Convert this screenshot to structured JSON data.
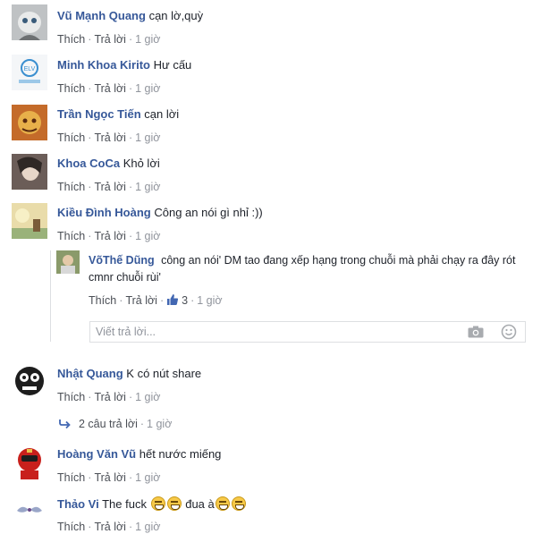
{
  "labels": {
    "like": "Thích",
    "reply": "Trả lời",
    "sep": "·"
  },
  "comments": [
    {
      "author": "Vũ Mạnh Quang",
      "text": "cạn lờ,quỳ",
      "time": "1 giờ"
    },
    {
      "author": "Minh Khoa Kirito",
      "text": "Hư cấu",
      "time": "1 giờ"
    },
    {
      "author": "Trần Ngọc Tiến",
      "text": "cạn lời",
      "time": "1 giờ"
    },
    {
      "author": "Khoa CoCa",
      "text": "Khỏ lời",
      "time": "1 giờ"
    },
    {
      "author": "Kiều Đình Hoàng",
      "text": "Công an nói gì nhỉ :))",
      "time": "1 giờ"
    },
    {
      "author": "Nhật Quang",
      "text": "K có nút share",
      "time": "1 giờ"
    },
    {
      "author": "Hoàng Văn Vũ",
      "text": "hết nước miếng",
      "time": "1 giờ"
    },
    {
      "author": "Thảo Vi",
      "text_before": "The fuck",
      "text_middle": "đua à",
      "time": "1 giờ"
    }
  ],
  "nested_reply": {
    "author": "VõThế Dũng",
    "text_line1": "công an nói' DM tao đang xếp hạng trong chuỗi mà phải chạy ra đây rót",
    "text_line2": "cmnr chuỗi rùi'",
    "like_count": "3",
    "time": "1 giờ"
  },
  "reply_input": {
    "placeholder": "Viết trả lời..."
  },
  "replies_link": {
    "text": "2 câu trả lời",
    "time": "1 giờ"
  },
  "colors": {
    "name": "#365899",
    "meta": "#90949c",
    "link": "#4b4f56",
    "like_icon": "#4267b2"
  },
  "icons": {
    "like": "thumbs-up-icon",
    "camera": "camera-icon",
    "emoji": "smiley-icon",
    "reply_arrow": "reply-arrow-icon",
    "laugh": "laughing-emoji-icon"
  }
}
